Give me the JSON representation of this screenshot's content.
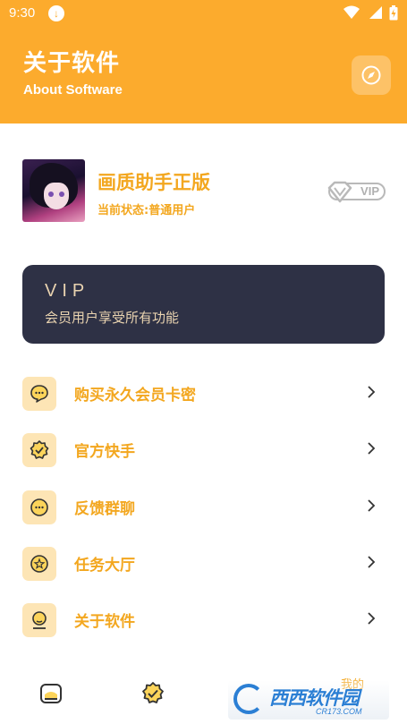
{
  "status_bar": {
    "time": "9:30"
  },
  "header": {
    "title": "关于软件",
    "subtitle": "About Software",
    "action_icon": "compass-icon"
  },
  "profile": {
    "name": "画质助手正版",
    "status": "当前状态:普通用户",
    "badge": "VIP"
  },
  "vip_card": {
    "title": "VIP",
    "description": "会员用户享受所有功能"
  },
  "menu": {
    "items": [
      {
        "label": "购买永久会员卡密",
        "icon": "chat-bubble-icon"
      },
      {
        "label": "官方快手",
        "icon": "badge-check-icon"
      },
      {
        "label": "反馈群聊",
        "icon": "message-dots-icon"
      },
      {
        "label": "任务大厅",
        "icon": "task-star-icon"
      },
      {
        "label": "关于软件",
        "icon": "user-info-icon"
      }
    ]
  },
  "bottom_nav": {
    "mine_label": "我的",
    "items": [
      {
        "icon": "home-icon"
      },
      {
        "icon": "badge-check-icon"
      }
    ]
  },
  "watermark": {
    "text": "西西软件园",
    "sub": "CR173.COM"
  },
  "colors": {
    "accent": "#fcab2d",
    "text_accent": "#f3a71f",
    "vip_card_bg": "#2e3145",
    "vip_text": "#e9d3b0",
    "icon_bg": "#fde5b5"
  }
}
